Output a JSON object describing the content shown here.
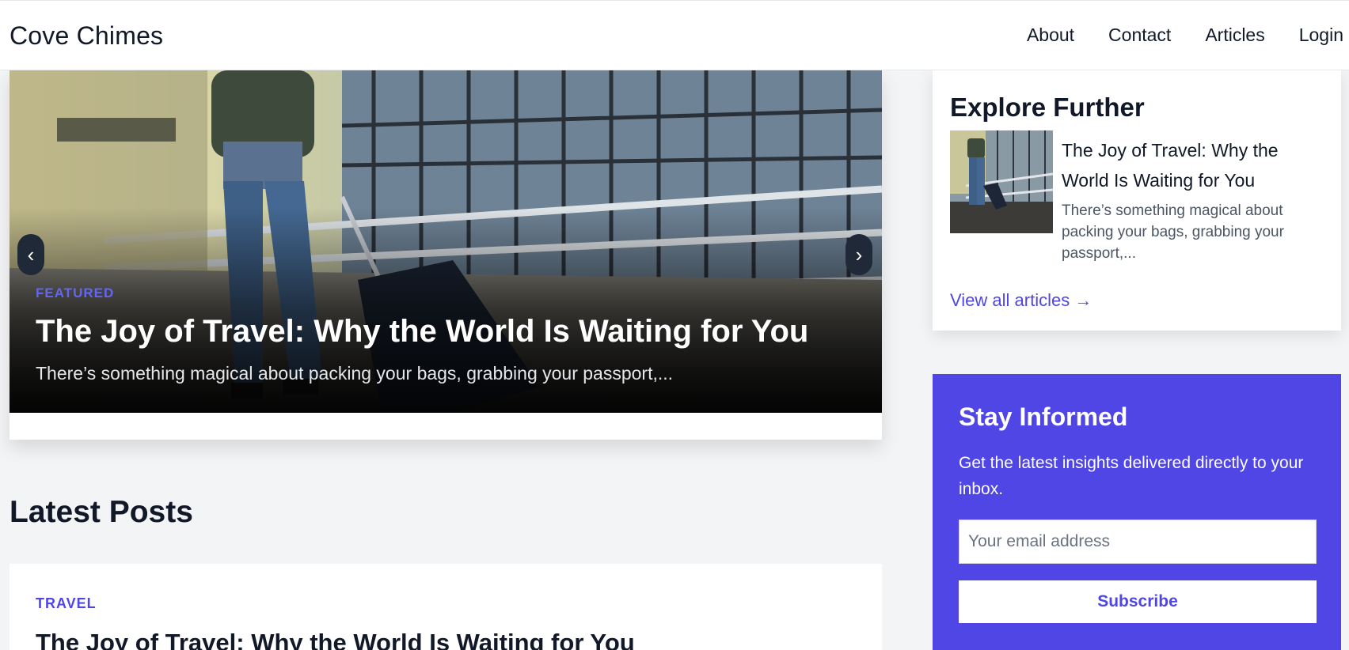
{
  "header": {
    "brand": "Cove Chimes",
    "nav": [
      "About",
      "Contact",
      "Articles",
      "Login"
    ]
  },
  "hero": {
    "tag": "FEATURED",
    "title": "The Joy of Travel: Why the World Is Waiting for You",
    "excerpt": "There’s something magical about packing your bags, grabbing your passport,...",
    "prev_icon": "chevron-left-icon",
    "next_icon": "chevron-right-icon"
  },
  "latest": {
    "heading": "Latest Posts",
    "posts": [
      {
        "category": "TRAVEL",
        "title": "The Joy of Travel: Why the World Is Waiting for You"
      }
    ]
  },
  "explore": {
    "heading": "Explore Further",
    "items": [
      {
        "title": "The Joy of Travel: Why the World Is Waiting for You",
        "excerpt": "There’s something magical about packing your bags, grabbing your passport,..."
      }
    ],
    "view_all": "View all articles →"
  },
  "newsletter": {
    "heading": "Stay Informed",
    "text": "Get the latest insights delivered directly to your inbox.",
    "placeholder": "Your email address",
    "button": "Subscribe"
  },
  "colors": {
    "accent": "#4f46e5",
    "page_bg": "#f3f4f6",
    "dark_arrow": "#1f2937"
  }
}
